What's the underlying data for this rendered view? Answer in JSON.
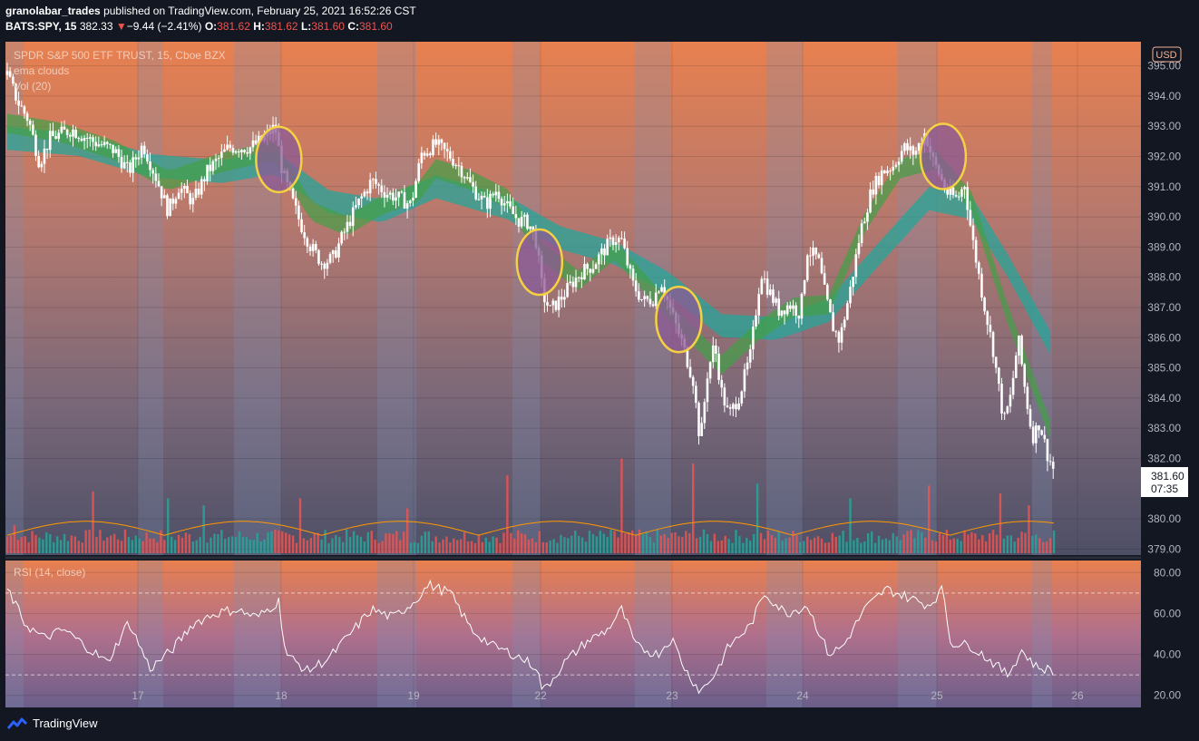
{
  "header": {
    "author": "granolabar_trades",
    "published_text": "published on TradingView.com, February 25, 2021 16:52:26 CST",
    "symbol": "BATS:SPY, 15",
    "last": "382.33",
    "change_arrow": "▼",
    "change": "−9.44 (−2.41%)",
    "o_label": "O:",
    "o": "381.62",
    "h_label": "H:",
    "h": "381.62",
    "l_label": "L:",
    "l": "381.60",
    "c_label": "C:",
    "c": "381.60"
  },
  "legend": {
    "title": "SPDR S&P 500 ETF TRUST, 15, Cboe BZX",
    "indicator1": "ema clouds",
    "indicator2": "Vol (20)",
    "rsi": "RSI (14, close)",
    "currency": "USD"
  },
  "price_label": {
    "value": "381.60",
    "countdown": "07:35"
  },
  "footer": {
    "brand": "TradingView"
  },
  "colors": {
    "background": "#131722",
    "candle": "#ffffff",
    "cloud_fast": "#43a047",
    "cloud_slow": "#26a69a",
    "highlight": "#f5d142",
    "vol_up": "#26a69a",
    "vol_down": "#ef5350",
    "vol_ma": "#ff9800",
    "rsi_line": "#ffffff"
  },
  "chart_data": {
    "type": "candlestick",
    "price_axis": {
      "ticks": [
        395,
        394,
        393,
        392,
        391,
        390,
        389,
        388,
        387,
        386,
        385,
        384,
        383,
        382,
        380,
        379
      ],
      "range": [
        378.8,
        395.8
      ]
    },
    "rsi_axis": {
      "ticks": [
        80,
        60,
        40,
        20
      ],
      "range": [
        15,
        85
      ],
      "bands": [
        70,
        30
      ]
    },
    "x_axis": {
      "labels": [
        "17",
        "18",
        "19",
        "22",
        "23",
        "24",
        "25",
        "26"
      ]
    },
    "price_path": [
      {
        "t": 0,
        "p": 394.7
      },
      {
        "t": 3,
        "p": 393.8
      },
      {
        "t": 6,
        "p": 393.2
      },
      {
        "t": 9,
        "p": 391.8
      },
      {
        "t": 12,
        "p": 392.6
      },
      {
        "t": 18,
        "p": 392.9
      },
      {
        "t": 24,
        "p": 392.5
      },
      {
        "t": 30,
        "p": 392.2
      },
      {
        "t": 34,
        "p": 391.5
      },
      {
        "t": 38,
        "p": 392.4
      },
      {
        "t": 42,
        "p": 391.2
      },
      {
        "t": 45,
        "p": 390.2
      },
      {
        "t": 48,
        "p": 391.0
      },
      {
        "t": 52,
        "p": 390.5
      },
      {
        "t": 56,
        "p": 391.5
      },
      {
        "t": 62,
        "p": 392.3
      },
      {
        "t": 68,
        "p": 392.3
      },
      {
        "t": 72,
        "p": 392.6
      },
      {
        "t": 75,
        "p": 393.0
      },
      {
        "t": 77,
        "p": 391.5
      },
      {
        "t": 79,
        "p": 390.8
      },
      {
        "t": 82,
        "p": 389.8
      },
      {
        "t": 85,
        "p": 389.0
      },
      {
        "t": 88,
        "p": 388.5
      },
      {
        "t": 91,
        "p": 388.6
      },
      {
        "t": 94,
        "p": 389.4
      },
      {
        "t": 98,
        "p": 390.4
      },
      {
        "t": 102,
        "p": 391.2
      },
      {
        "t": 106,
        "p": 390.8
      },
      {
        "t": 110,
        "p": 390.6
      },
      {
        "t": 113,
        "p": 390.4
      },
      {
        "t": 116,
        "p": 392.1
      },
      {
        "t": 120,
        "p": 392.4
      },
      {
        "t": 124,
        "p": 392.0
      },
      {
        "t": 127,
        "p": 391.6
      },
      {
        "t": 130,
        "p": 391.0
      },
      {
        "t": 134,
        "p": 390.4
      },
      {
        "t": 137,
        "p": 390.9
      },
      {
        "t": 140,
        "p": 390.3
      },
      {
        "t": 143,
        "p": 389.9
      },
      {
        "t": 146,
        "p": 389.8
      },
      {
        "t": 148,
        "p": 389.2
      },
      {
        "t": 150,
        "p": 387.4
      },
      {
        "t": 152,
        "p": 386.9
      },
      {
        "t": 155,
        "p": 387.3
      },
      {
        "t": 158,
        "p": 387.8
      },
      {
        "t": 161,
        "p": 388.2
      },
      {
        "t": 164,
        "p": 388.4
      },
      {
        "t": 167,
        "p": 388.9
      },
      {
        "t": 170,
        "p": 389.3
      },
      {
        "t": 172,
        "p": 389.2
      },
      {
        "t": 175,
        "p": 387.8
      },
      {
        "t": 178,
        "p": 387.2
      },
      {
        "t": 181,
        "p": 387.3
      },
      {
        "t": 183,
        "p": 387.9
      },
      {
        "t": 186,
        "p": 386.8
      },
      {
        "t": 189,
        "p": 385.8
      },
      {
        "t": 192,
        "p": 384.6
      },
      {
        "t": 194,
        "p": 382.5
      },
      {
        "t": 196,
        "p": 384.8
      },
      {
        "t": 198,
        "p": 385.8
      },
      {
        "t": 200,
        "p": 384.2
      },
      {
        "t": 202,
        "p": 383.4
      },
      {
        "t": 205,
        "p": 384.1
      },
      {
        "t": 208,
        "p": 385.4
      },
      {
        "t": 211,
        "p": 388.2
      },
      {
        "t": 213,
        "p": 387.6
      },
      {
        "t": 216,
        "p": 386.9
      },
      {
        "t": 219,
        "p": 387.1
      },
      {
        "t": 222,
        "p": 386.8
      },
      {
        "t": 224,
        "p": 388.9
      },
      {
        "t": 227,
        "p": 388.6
      },
      {
        "t": 229,
        "p": 387.4
      },
      {
        "t": 231,
        "p": 386.4
      },
      {
        "t": 233,
        "p": 385.9
      },
      {
        "t": 236,
        "p": 387.6
      },
      {
        "t": 239,
        "p": 389.6
      },
      {
        "t": 242,
        "p": 390.9
      },
      {
        "t": 245,
        "p": 391.5
      },
      {
        "t": 248,
        "p": 391.7
      },
      {
        "t": 251,
        "p": 392.3
      },
      {
        "t": 254,
        "p": 392.1
      },
      {
        "t": 257,
        "p": 392.8
      },
      {
        "t": 259,
        "p": 391.9
      },
      {
        "t": 261,
        "p": 391.4
      },
      {
        "t": 263,
        "p": 390.8
      },
      {
        "t": 266,
        "p": 390.6
      },
      {
        "t": 268,
        "p": 391.1
      },
      {
        "t": 270,
        "p": 389.4
      },
      {
        "t": 273,
        "p": 387.4
      },
      {
        "t": 276,
        "p": 385.6
      },
      {
        "t": 279,
        "p": 383.2
      },
      {
        "t": 281,
        "p": 384.1
      },
      {
        "t": 283,
        "p": 386.0
      },
      {
        "t": 285,
        "p": 384.2
      },
      {
        "t": 287,
        "p": 382.7
      },
      {
        "t": 289,
        "p": 383.2
      },
      {
        "t": 291,
        "p": 382.2
      },
      {
        "t": 293,
        "p": 381.6
      }
    ],
    "cloud_fast": [
      {
        "t": 0,
        "p": 393.1
      },
      {
        "t": 15,
        "p": 392.8
      },
      {
        "t": 30,
        "p": 392.2
      },
      {
        "t": 45,
        "p": 391.2
      },
      {
        "t": 60,
        "p": 391.8
      },
      {
        "t": 75,
        "p": 392.2
      },
      {
        "t": 85,
        "p": 390.2
      },
      {
        "t": 95,
        "p": 389.7
      },
      {
        "t": 105,
        "p": 390.4
      },
      {
        "t": 115,
        "p": 390.8
      },
      {
        "t": 120,
        "p": 391.6
      },
      {
        "t": 130,
        "p": 391.2
      },
      {
        "t": 140,
        "p": 390.6
      },
      {
        "t": 150,
        "p": 388.8
      },
      {
        "t": 160,
        "p": 387.9
      },
      {
        "t": 170,
        "p": 388.9
      },
      {
        "t": 180,
        "p": 387.6
      },
      {
        "t": 190,
        "p": 386.3
      },
      {
        "t": 200,
        "p": 385.1
      },
      {
        "t": 210,
        "p": 386.2
      },
      {
        "t": 220,
        "p": 387.0
      },
      {
        "t": 230,
        "p": 387.1
      },
      {
        "t": 240,
        "p": 389.8
      },
      {
        "t": 250,
        "p": 391.6
      },
      {
        "t": 260,
        "p": 391.9
      },
      {
        "t": 270,
        "p": 390.5
      },
      {
        "t": 280,
        "p": 386.8
      },
      {
        "t": 293,
        "p": 382.6
      }
    ],
    "cloud_slow": [
      {
        "t": 0,
        "p": 392.6
      },
      {
        "t": 20,
        "p": 392.4
      },
      {
        "t": 40,
        "p": 391.7
      },
      {
        "t": 60,
        "p": 391.5
      },
      {
        "t": 75,
        "p": 391.8
      },
      {
        "t": 90,
        "p": 390.5
      },
      {
        "t": 105,
        "p": 390.2
      },
      {
        "t": 120,
        "p": 391.0
      },
      {
        "t": 140,
        "p": 390.3
      },
      {
        "t": 155,
        "p": 389.3
      },
      {
        "t": 170,
        "p": 388.8
      },
      {
        "t": 185,
        "p": 387.8
      },
      {
        "t": 200,
        "p": 386.4
      },
      {
        "t": 215,
        "p": 386.3
      },
      {
        "t": 230,
        "p": 386.9
      },
      {
        "t": 245,
        "p": 388.9
      },
      {
        "t": 258,
        "p": 390.6
      },
      {
        "t": 270,
        "p": 390.3
      },
      {
        "t": 280,
        "p": 388.4
      },
      {
        "t": 293,
        "p": 385.6
      }
    ],
    "highlights": [
      {
        "t": 76,
        "p": 391.9
      },
      {
        "t": 149,
        "p": 388.5
      },
      {
        "t": 188,
        "p": 386.6
      },
      {
        "t": 262,
        "p": 392.0
      }
    ],
    "rsi": [
      {
        "t": 0,
        "p": 72
      },
      {
        "t": 5,
        "p": 55
      },
      {
        "t": 10,
        "p": 48
      },
      {
        "t": 16,
        "p": 52
      },
      {
        "t": 22,
        "p": 44
      },
      {
        "t": 28,
        "p": 36
      },
      {
        "t": 34,
        "p": 56
      },
      {
        "t": 40,
        "p": 33
      },
      {
        "t": 46,
        "p": 42
      },
      {
        "t": 52,
        "p": 55
      },
      {
        "t": 58,
        "p": 60
      },
      {
        "t": 64,
        "p": 62
      },
      {
        "t": 70,
        "p": 58
      },
      {
        "t": 76,
        "p": 66
      },
      {
        "t": 78,
        "p": 40
      },
      {
        "t": 84,
        "p": 32
      },
      {
        "t": 90,
        "p": 38
      },
      {
        "t": 96,
        "p": 50
      },
      {
        "t": 102,
        "p": 62
      },
      {
        "t": 108,
        "p": 58
      },
      {
        "t": 114,
        "p": 66
      },
      {
        "t": 118,
        "p": 74
      },
      {
        "t": 124,
        "p": 70
      },
      {
        "t": 130,
        "p": 52
      },
      {
        "t": 136,
        "p": 44
      },
      {
        "t": 142,
        "p": 40
      },
      {
        "t": 148,
        "p": 34
      },
      {
        "t": 150,
        "p": 22
      },
      {
        "t": 156,
        "p": 36
      },
      {
        "t": 162,
        "p": 46
      },
      {
        "t": 168,
        "p": 52
      },
      {
        "t": 172,
        "p": 62
      },
      {
        "t": 176,
        "p": 44
      },
      {
        "t": 182,
        "p": 40
      },
      {
        "t": 186,
        "p": 48
      },
      {
        "t": 190,
        "p": 32
      },
      {
        "t": 194,
        "p": 22
      },
      {
        "t": 198,
        "p": 30
      },
      {
        "t": 202,
        "p": 44
      },
      {
        "t": 208,
        "p": 54
      },
      {
        "t": 212,
        "p": 70
      },
      {
        "t": 218,
        "p": 60
      },
      {
        "t": 224,
        "p": 64
      },
      {
        "t": 230,
        "p": 40
      },
      {
        "t": 234,
        "p": 44
      },
      {
        "t": 240,
        "p": 62
      },
      {
        "t": 246,
        "p": 72
      },
      {
        "t": 252,
        "p": 68
      },
      {
        "t": 258,
        "p": 64
      },
      {
        "t": 262,
        "p": 72
      },
      {
        "t": 264,
        "p": 46
      },
      {
        "t": 270,
        "p": 44
      },
      {
        "t": 276,
        "p": 36
      },
      {
        "t": 280,
        "p": 30
      },
      {
        "t": 284,
        "p": 42
      },
      {
        "t": 288,
        "p": 34
      },
      {
        "t": 293,
        "p": 32
      }
    ],
    "volume": {
      "baseline_bars": 10,
      "spikes": [
        {
          "t": 2,
          "v": 28
        },
        {
          "t": 24,
          "v": 62
        },
        {
          "t": 45,
          "v": 55
        },
        {
          "t": 55,
          "v": 48
        },
        {
          "t": 82,
          "v": 55
        },
        {
          "t": 112,
          "v": 45
        },
        {
          "t": 140,
          "v": 78
        },
        {
          "t": 172,
          "v": 95
        },
        {
          "t": 192,
          "v": 90
        },
        {
          "t": 210,
          "v": 70
        },
        {
          "t": 236,
          "v": 55
        },
        {
          "t": 258,
          "v": 68
        },
        {
          "t": 278,
          "v": 60
        },
        {
          "t": 286,
          "v": 48
        }
      ]
    }
  }
}
